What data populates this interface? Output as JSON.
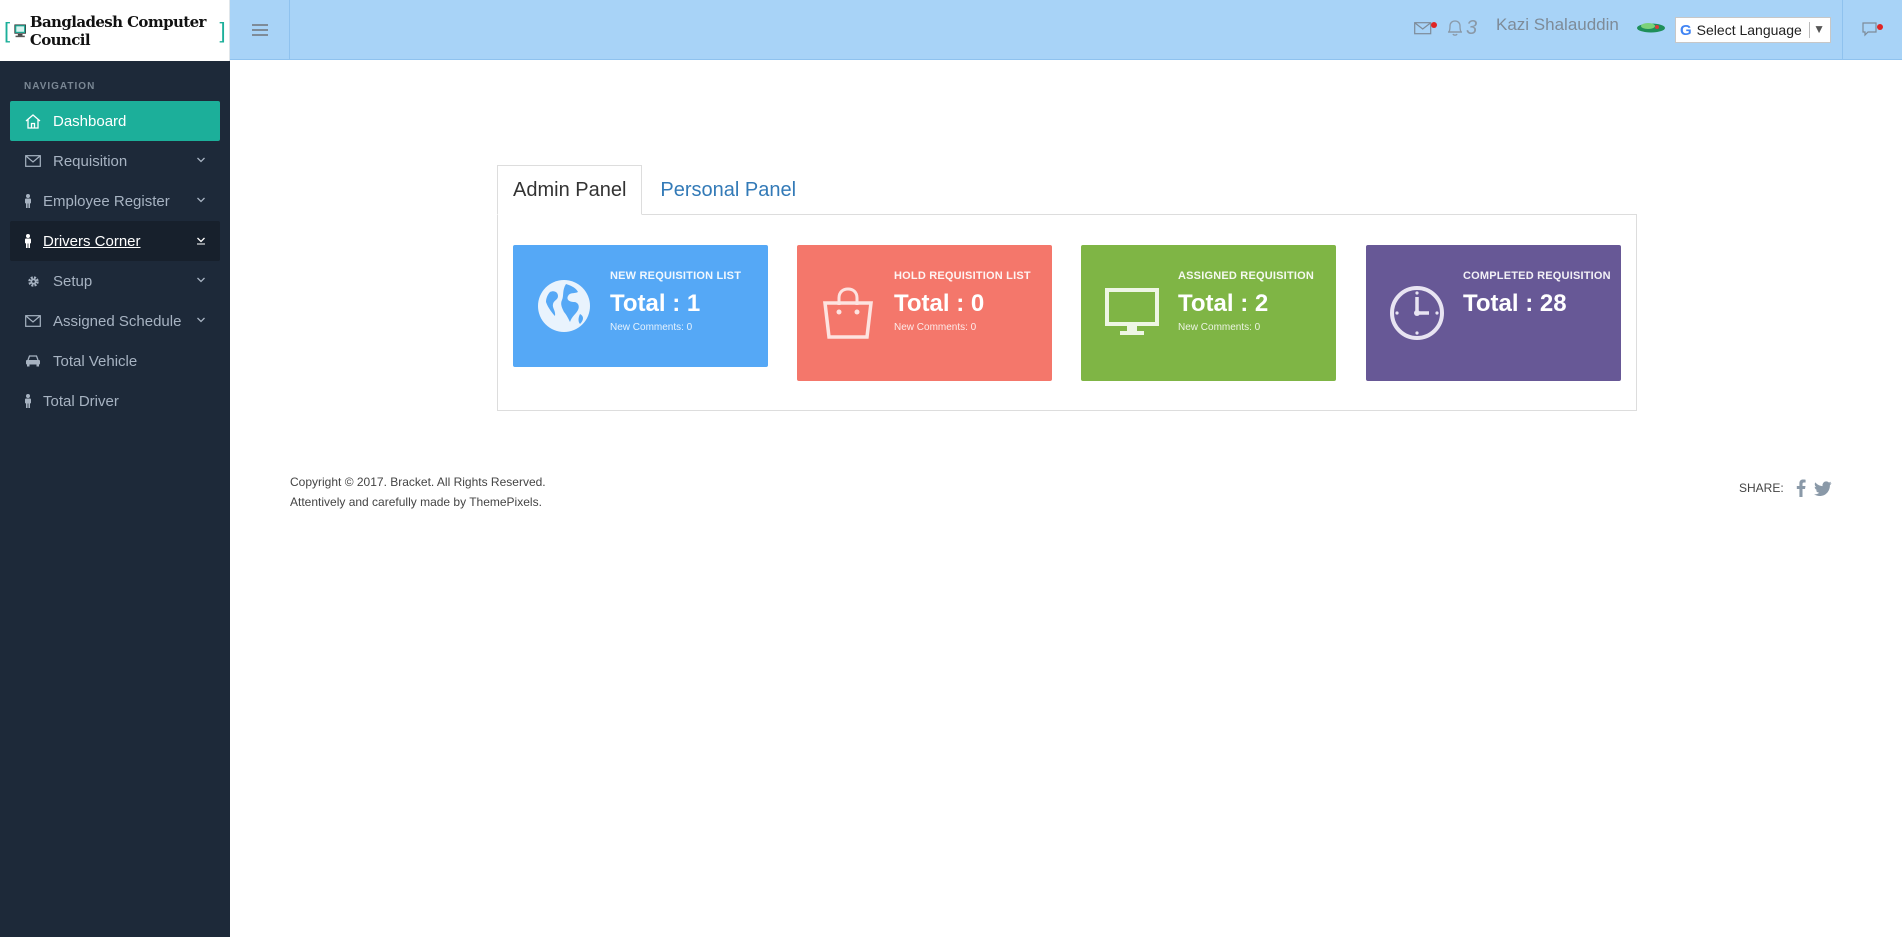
{
  "logo": {
    "text": "Bangladesh Computer Council",
    "bracket_open": "[",
    "bracket_close": "]"
  },
  "sidebar": {
    "heading": "NAVIGATION",
    "items": [
      {
        "label": "Dashboard",
        "icon": "home-icon",
        "state": "active"
      },
      {
        "label": "Requisition",
        "icon": "envelope-icon",
        "has_submenu": true
      },
      {
        "label": "Employee Register",
        "icon": "person-icon",
        "has_submenu": true
      },
      {
        "label": "Drivers Corner",
        "icon": "person-icon",
        "has_submenu": true,
        "state": "hover"
      },
      {
        "label": "Setup",
        "icon": "gear-icon",
        "has_submenu": true
      },
      {
        "label": "Assigned Schedule",
        "icon": "envelope-icon",
        "has_submenu": true
      },
      {
        "label": "Total Vehicle",
        "icon": "car-icon"
      },
      {
        "label": "Total Driver",
        "icon": "person-icon"
      }
    ]
  },
  "header": {
    "notification_count": "3",
    "user_name": "Kazi Shalauddin",
    "language_select": "Select Language",
    "language_arrow": "▼",
    "google_mark": "G"
  },
  "tabs": [
    {
      "label": "Admin Panel",
      "active": true
    },
    {
      "label": "Personal Panel",
      "active": false
    }
  ],
  "cards": [
    {
      "caption": "NEW REQUISITION LIST",
      "total": "Total : 1",
      "comments": "New Comments: 0",
      "icon": "globe-icon",
      "color": "#55a8f6"
    },
    {
      "caption": "HOLD REQUISITION LIST",
      "total": "Total : 0",
      "comments": "New Comments: 0",
      "icon": "shopping-bag-icon",
      "color": "#f4776b"
    },
    {
      "caption": "ASSIGNED REQUISITION",
      "total": "Total : 2",
      "comments": "New Comments: 0",
      "icon": "monitor-icon",
      "color": "#7fb545"
    },
    {
      "caption": "COMPLETED REQUISITION",
      "total": "Total : 28",
      "icon": "clock-icon",
      "color": "#675896"
    }
  ],
  "footer": {
    "copyright": "Copyright © 2017. Bracket. All Rights Reserved.",
    "credit": "Attentively and carefully made by ThemePixels.",
    "share_label": "SHARE:"
  },
  "colors": {
    "sidebar_bg": "#1d2939",
    "header_bg": "#a8d3f7",
    "accent": "#1caf9a"
  }
}
